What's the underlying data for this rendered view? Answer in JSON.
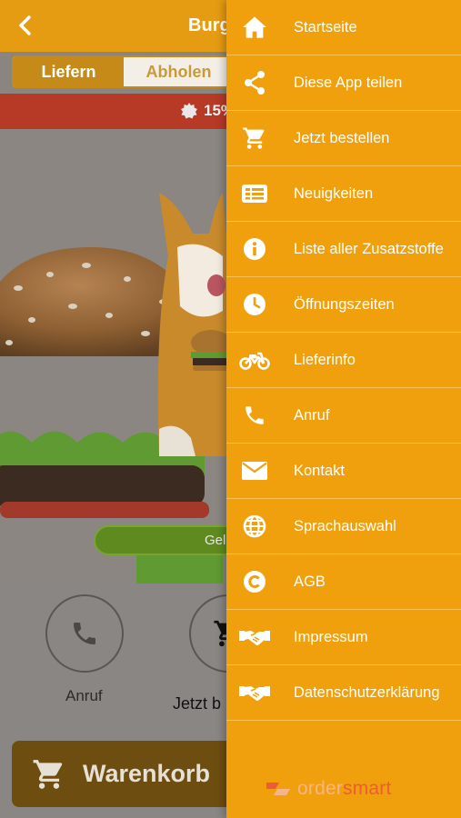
{
  "header": {
    "title": "Burge"
  },
  "mode_toggle": {
    "options": [
      "Liefern",
      "Abholen"
    ],
    "selected": "Liefern"
  },
  "promo": {
    "text": "15%"
  },
  "status_pill": {
    "text": "Gel"
  },
  "actions": {
    "call_label": "Anruf",
    "order_label": "Jetzt b"
  },
  "cart": {
    "label": "Warenkorb"
  },
  "drawer": {
    "items": [
      {
        "label": "Startseite",
        "icon": "home-icon"
      },
      {
        "label": "Diese App teilen",
        "icon": "share-icon"
      },
      {
        "label": "Jetzt bestellen",
        "icon": "cart-icon"
      },
      {
        "label": "Neuigkeiten",
        "icon": "news-icon"
      },
      {
        "label": "Liste aller Zusatzstoffe",
        "icon": "info-icon"
      },
      {
        "label": "Öffnungszeiten",
        "icon": "clock-icon"
      },
      {
        "label": "Lieferinfo",
        "icon": "motorbike-icon"
      },
      {
        "label": "Anruf",
        "icon": "phone-icon"
      },
      {
        "label": "Kontakt",
        "icon": "mail-icon"
      },
      {
        "label": "Sprachauswahl",
        "icon": "globe-icon"
      },
      {
        "label": "AGB",
        "icon": "copyright-icon"
      },
      {
        "label": "Impressum",
        "icon": "handshake-icon"
      },
      {
        "label": "Datenschutzerklärung",
        "icon": "handshake-icon"
      }
    ],
    "brand": {
      "part1": "order",
      "part2": "smart"
    }
  },
  "colors": {
    "accent": "#f0a00c",
    "header": "#e59b12",
    "promo": "#b63a26",
    "status": "#5f8a1f"
  }
}
